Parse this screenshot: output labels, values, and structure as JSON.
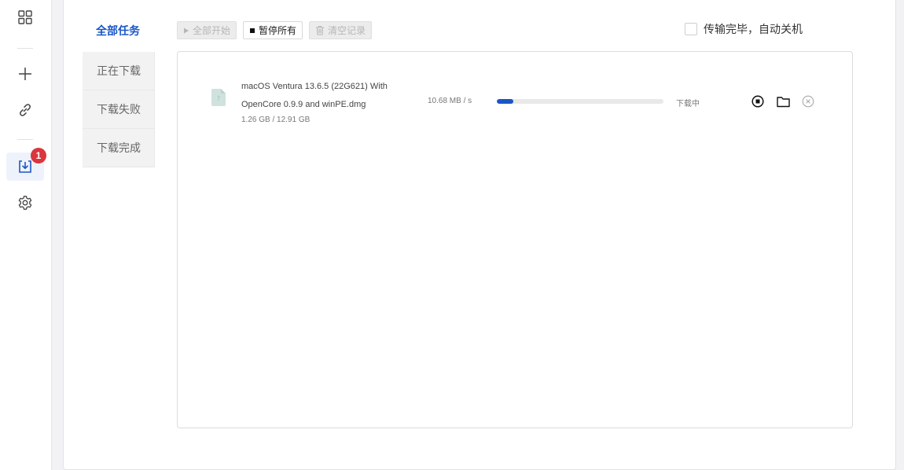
{
  "sidebar": {
    "items": [
      {
        "icon": "grid-icon"
      },
      {
        "icon": "plus-icon"
      },
      {
        "icon": "link-icon"
      },
      {
        "icon": "download-icon",
        "badge": "1",
        "active": true
      },
      {
        "icon": "gear-icon"
      }
    ]
  },
  "tabs": [
    {
      "label": "全部任务",
      "active": true
    },
    {
      "label": "正在下载"
    },
    {
      "label": "下载失败"
    },
    {
      "label": "下载完成"
    }
  ],
  "toolbar": {
    "start_all_label": "全部开始",
    "pause_all_label": "暂停所有",
    "clear_label": "清空记录"
  },
  "auto_shutdown": {
    "label": "传输完毕，自动关机",
    "checked": false
  },
  "downloads": [
    {
      "name_line1": "macOS Ventura 13.6.5 (22G621) With",
      "name_line2": "OpenCore 0.9.9 and winPE.dmg",
      "size": "1.26 GB / 12.91 GB",
      "speed": "10.68 MB / s",
      "progress": 0.098,
      "status": "下载中"
    }
  ],
  "colors": {
    "accent": "#1a56c5",
    "badge": "#d9363e",
    "file_icon": "#cfe2de"
  }
}
